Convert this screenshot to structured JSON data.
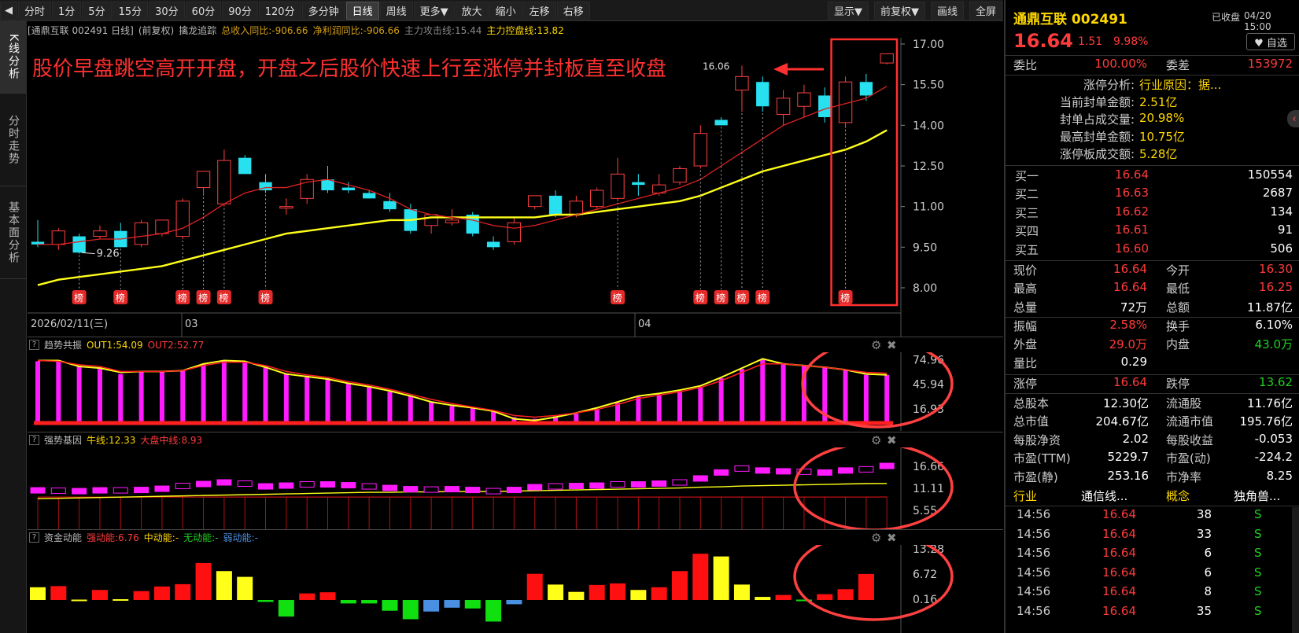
{
  "toolbar": {
    "left": [
      "分时",
      "1分",
      "5分",
      "15分",
      "30分",
      "60分",
      "90分",
      "120分",
      "多分钟",
      "日线",
      "周线",
      "更多▼",
      "放大",
      "缩小",
      "左移",
      "右移"
    ],
    "active": "日线",
    "right": [
      "显示▼",
      "前复权▼",
      "画线",
      "全屏"
    ]
  },
  "sidebar": {
    "tabs": [
      "K线分析",
      "分时走势",
      "基本面分析"
    ]
  },
  "kline": {
    "header": {
      "stock": "[通鼎互联 002491 日线]",
      "adj": "(前复权)",
      "indicator_name": "擒龙追踪",
      "revenue_label": "总收入同比:-906.66",
      "profit_label": "净利润同比:-906.66",
      "attack_label": "主力攻击线:15.44",
      "control_label": "主力控盘线:13.82"
    },
    "annotation": "股价早盘跳空高开开盘，开盘之后股价快速上行至涨停并封板直至收盘",
    "low_label": "9.26",
    "high_label": "16.06",
    "date_label": "2026/02/11(三)",
    "month_labels": [
      "03",
      "04"
    ],
    "y_ticks": [
      "17.00",
      "15.50",
      "14.00",
      "12.50",
      "11.00",
      "9.50",
      "8.00"
    ],
    "bang": "榜"
  },
  "panel1": {
    "name": "趋势共振",
    "out1": "OUT1:54.09",
    "out2": "OUT2:52.77",
    "y_ticks": [
      "74.96",
      "45.94",
      "16.93"
    ]
  },
  "panel2": {
    "name": "强势基因",
    "bull": "牛线:12.33",
    "market": "大盘中线:8.93",
    "y_ticks": [
      "16.66",
      "11.11",
      "5.55"
    ]
  },
  "panel3": {
    "name": "资金动能",
    "strong": "强动能:6.76",
    "mid": "中动能:-",
    "none": "无动能:-",
    "weak": "弱动能:-",
    "y_ticks": [
      "13.28",
      "6.72",
      "0.16"
    ]
  },
  "quote": {
    "title": "通鼎互联 002491",
    "status": "已收盘",
    "time": "04/20 15:00",
    "price": "16.64",
    "change": "1.51",
    "pct": "9.98%",
    "watch": "♥ 自选",
    "weibi_label": "委比",
    "weibi": "100.00%",
    "weicha_label": "委差",
    "weicha": "153972",
    "limit_rows": [
      {
        "k": "涨停分析:",
        "v": "行业原因：据..."
      },
      {
        "k": "当前封单金额:",
        "v": "2.51亿"
      },
      {
        "k": "封单占成交量:",
        "v": "20.98%"
      },
      {
        "k": "最高封单金额:",
        "v": "10.75亿"
      },
      {
        "k": "涨停板成交额:",
        "v": "5.28亿"
      }
    ],
    "bids": [
      {
        "k": "买一",
        "p": "16.64",
        "v": "150554"
      },
      {
        "k": "买二",
        "p": "16.63",
        "v": "2687"
      },
      {
        "k": "买三",
        "p": "16.62",
        "v": "134"
      },
      {
        "k": "买四",
        "p": "16.61",
        "v": "91"
      },
      {
        "k": "买五",
        "p": "16.60",
        "v": "506"
      }
    ],
    "stats": [
      {
        "k1": "现价",
        "v1": "16.64",
        "c1": "red",
        "k2": "今开",
        "v2": "16.30",
        "c2": "red"
      },
      {
        "k1": "最高",
        "v1": "16.64",
        "c1": "red",
        "k2": "最低",
        "v2": "16.25",
        "c2": "red"
      },
      {
        "k1": "总量",
        "v1": "72万",
        "c1": "white",
        "k2": "总额",
        "v2": "11.87亿",
        "c2": "white"
      }
    ],
    "stats2": [
      {
        "k1": "振幅",
        "v1": "2.58%",
        "c1": "red",
        "k2": "换手",
        "v2": "6.10%",
        "c2": "white"
      },
      {
        "k1": "外盘",
        "v1": "29.0万",
        "c1": "red",
        "k2": "内盘",
        "v2": "43.0万",
        "c2": "green"
      },
      {
        "k1": "量比",
        "v1": "0.29",
        "c1": "white",
        "k2": "",
        "v2": "",
        "c2": "white"
      }
    ],
    "stats3": [
      {
        "k1": "涨停",
        "v1": "16.64",
        "c1": "red",
        "k2": "跌停",
        "v2": "13.62",
        "c2": "green"
      }
    ],
    "fund": [
      {
        "k1": "总股本",
        "v1": "12.30亿",
        "k2": "流通股",
        "v2": "11.76亿"
      },
      {
        "k1": "总市值",
        "v1": "204.67亿",
        "k2": "流通市值",
        "v2": "195.76亿"
      },
      {
        "k1": "每股净资",
        "v1": "2.02",
        "k2": "每股收益",
        "v2": "-0.053"
      },
      {
        "k1": "市盈(TTM)",
        "v1": "5229.7",
        "k2": "市盈(动)",
        "v2": "-224.2"
      },
      {
        "k1": "市盈(静)",
        "v1": "253.16",
        "k2": "市净率",
        "v2": "8.25"
      }
    ],
    "industry_label": "行业",
    "industry": "通信线...",
    "concept_label": "概念",
    "concept": "独角兽...",
    "ticks": [
      {
        "t": "14:56",
        "p": "16.64",
        "v": "38",
        "s": "S"
      },
      {
        "t": "14:56",
        "p": "16.64",
        "v": "33",
        "s": "S"
      },
      {
        "t": "14:56",
        "p": "16.64",
        "v": "6",
        "s": "S"
      },
      {
        "t": "14:56",
        "p": "16.64",
        "v": "6",
        "s": "S"
      },
      {
        "t": "14:56",
        "p": "16.64",
        "v": "8",
        "s": "S"
      },
      {
        "t": "14:56",
        "p": "16.64",
        "v": "35",
        "s": "S"
      }
    ]
  },
  "chart_data": [
    {
      "type": "candlestick",
      "title": "通鼎互联 002491 日线",
      "ylim": [
        8.0,
        17.0
      ],
      "y_ticks": [
        8.0,
        9.5,
        11.0,
        12.5,
        14.0,
        15.5,
        17.0
      ],
      "candles": [
        {
          "o": 9.7,
          "h": 10.5,
          "l": 9.5,
          "c": 9.6
        },
        {
          "o": 9.6,
          "h": 10.2,
          "l": 9.4,
          "c": 10.1
        },
        {
          "o": 9.9,
          "h": 10.0,
          "l": 9.26,
          "c": 9.3
        },
        {
          "o": 9.9,
          "h": 10.3,
          "l": 9.8,
          "c": 10.1
        },
        {
          "o": 10.1,
          "h": 10.4,
          "l": 9.5,
          "c": 9.5
        },
        {
          "o": 9.6,
          "h": 10.5,
          "l": 9.5,
          "c": 10.4
        },
        {
          "o": 10.0,
          "h": 10.5,
          "l": 9.9,
          "c": 10.5
        },
        {
          "o": 9.9,
          "h": 11.3,
          "l": 9.8,
          "c": 11.2
        },
        {
          "o": 11.7,
          "h": 12.3,
          "l": 11.4,
          "c": 12.3
        },
        {
          "o": 11.1,
          "h": 13.1,
          "l": 11.0,
          "c": 12.7
        },
        {
          "o": 12.8,
          "h": 12.9,
          "l": 12.3,
          "c": 12.2
        },
        {
          "o": 11.9,
          "h": 12.2,
          "l": 11.5,
          "c": 11.6
        },
        {
          "o": 11.0,
          "h": 11.3,
          "l": 10.7,
          "c": 11.0
        },
        {
          "o": 11.3,
          "h": 12.2,
          "l": 11.1,
          "c": 12.0
        },
        {
          "o": 12.0,
          "h": 12.5,
          "l": 11.5,
          "c": 11.6
        },
        {
          "o": 11.7,
          "h": 11.9,
          "l": 11.5,
          "c": 11.6
        },
        {
          "o": 11.5,
          "h": 11.6,
          "l": 11.3,
          "c": 11.3
        },
        {
          "o": 11.2,
          "h": 11.5,
          "l": 10.8,
          "c": 10.9
        },
        {
          "o": 10.9,
          "h": 11.1,
          "l": 10.0,
          "c": 10.1
        },
        {
          "o": 10.3,
          "h": 10.7,
          "l": 10.0,
          "c": 10.7
        },
        {
          "o": 10.4,
          "h": 10.9,
          "l": 10.3,
          "c": 10.5
        },
        {
          "o": 10.7,
          "h": 10.8,
          "l": 9.9,
          "c": 10.0
        },
        {
          "o": 9.7,
          "h": 9.9,
          "l": 9.4,
          "c": 9.5
        },
        {
          "o": 9.7,
          "h": 10.6,
          "l": 9.6,
          "c": 10.4
        },
        {
          "o": 11.0,
          "h": 11.4,
          "l": 10.9,
          "c": 11.4
        },
        {
          "o": 11.4,
          "h": 11.6,
          "l": 10.6,
          "c": 10.7
        },
        {
          "o": 10.7,
          "h": 11.4,
          "l": 10.6,
          "c": 11.2
        },
        {
          "o": 11.0,
          "h": 11.7,
          "l": 10.9,
          "c": 11.6
        },
        {
          "o": 11.3,
          "h": 12.8,
          "l": 11.2,
          "c": 12.2
        },
        {
          "o": 11.9,
          "h": 12.2,
          "l": 11.4,
          "c": 11.8
        },
        {
          "o": 11.5,
          "h": 12.2,
          "l": 11.4,
          "c": 11.8
        },
        {
          "o": 11.9,
          "h": 12.5,
          "l": 11.8,
          "c": 12.4
        },
        {
          "o": 12.5,
          "h": 14.0,
          "l": 12.4,
          "c": 13.7
        },
        {
          "o": 14.2,
          "h": 14.3,
          "l": 14.0,
          "c": 14.0
        },
        {
          "o": 15.3,
          "h": 16.2,
          "l": 14.5,
          "c": 15.8
        },
        {
          "o": 15.6,
          "h": 15.8,
          "l": 14.5,
          "c": 14.7
        },
        {
          "o": 14.4,
          "h": 15.3,
          "l": 14.0,
          "c": 15.0
        },
        {
          "o": 14.7,
          "h": 15.5,
          "l": 14.3,
          "c": 15.2
        },
        {
          "o": 15.1,
          "h": 15.4,
          "l": 14.1,
          "c": 14.3
        },
        {
          "o": 14.1,
          "h": 15.8,
          "l": 13.9,
          "c": 15.6
        },
        {
          "o": 15.6,
          "h": 15.9,
          "l": 14.9,
          "c": 15.1
        },
        {
          "o": 16.3,
          "h": 16.64,
          "l": 16.25,
          "c": 16.64
        }
      ],
      "ma_attack": [
        9.6,
        9.6,
        9.7,
        9.8,
        9.8,
        9.9,
        10.0,
        10.2,
        10.6,
        11.1,
        11.5,
        11.7,
        11.7,
        11.9,
        12.0,
        11.8,
        11.6,
        11.3,
        10.9,
        10.7,
        10.6,
        10.5,
        10.3,
        10.2,
        10.3,
        10.5,
        10.7,
        10.9,
        11.1,
        11.3,
        11.5,
        11.7,
        12.0,
        12.5,
        13.0,
        13.5,
        14.0,
        14.3,
        14.6,
        14.8,
        15.0,
        15.44
      ],
      "ma_control": [
        8.1,
        8.3,
        8.4,
        8.5,
        8.6,
        8.7,
        8.8,
        9.0,
        9.2,
        9.4,
        9.6,
        9.8,
        10.0,
        10.1,
        10.2,
        10.3,
        10.4,
        10.5,
        10.5,
        10.6,
        10.6,
        10.6,
        10.6,
        10.6,
        10.6,
        10.7,
        10.7,
        10.8,
        10.9,
        11.0,
        11.1,
        11.2,
        11.4,
        11.7,
        12.0,
        12.3,
        12.5,
        12.7,
        12.9,
        13.1,
        13.4,
        13.82
      ],
      "bang_days": [
        2,
        4,
        7,
        8,
        9,
        11,
        28,
        32,
        33,
        34,
        35,
        39
      ]
    },
    {
      "type": "bar",
      "title": "趋势共振",
      "ylim": [
        0,
        80
      ],
      "y_ticks": [
        16.93,
        45.94,
        74.96
      ],
      "values": [
        73,
        73,
        68,
        66,
        58,
        61,
        61,
        63,
        70,
        73,
        72,
        67,
        58,
        56,
        53,
        47,
        43,
        37,
        32,
        25,
        20,
        18,
        14,
        7,
        5,
        8,
        11,
        17,
        24,
        31,
        34,
        38,
        43,
        53,
        64,
        75,
        71,
        68,
        67,
        63,
        57,
        57,
        55,
        54.09
      ],
      "out1": [
        74,
        74,
        67,
        65,
        60,
        61,
        61,
        62,
        70,
        74,
        73,
        66,
        58,
        55,
        52,
        47,
        43,
        38,
        32,
        25,
        21,
        18,
        14,
        5,
        3,
        7,
        12,
        18,
        25,
        32,
        35,
        39,
        44,
        54,
        65,
        76,
        70,
        68,
        66,
        63,
        58,
        57,
        56,
        54.09
      ],
      "out2": [
        74,
        73,
        69,
        67,
        61,
        61,
        61,
        62,
        68,
        72,
        72,
        68,
        61,
        57,
        54,
        49,
        45,
        40,
        34,
        28,
        23,
        19,
        15,
        9,
        7,
        9,
        12,
        16,
        22,
        29,
        33,
        37,
        42,
        50,
        60,
        70,
        70,
        68,
        66,
        63,
        60,
        59,
        57,
        52.77
      ]
    },
    {
      "type": "bar",
      "title": "强势基因",
      "ylim": [
        0,
        20
      ],
      "y_ticks": [
        5.55,
        11.11,
        16.66
      ],
      "values": [
        10.5,
        10.4,
        10.3,
        10.5,
        10.5,
        10.6,
        10.9,
        11.6,
        12.1,
        12.5,
        12.2,
        11.5,
        11.7,
        12.0,
        12.0,
        11.8,
        11.5,
        11.1,
        10.8,
        10.7,
        10.8,
        10.6,
        10.3,
        10.6,
        11.3,
        11.5,
        11.6,
        11.7,
        12.0,
        12.0,
        12.2,
        12.5,
        13.5,
        15.0,
        16.0,
        15.5,
        15.3,
        15.2,
        15.0,
        15.5,
        15.8,
        16.66
      ],
      "bull": [
        8.5,
        8.6,
        8.7,
        8.8,
        8.9,
        9.0,
        9.1,
        9.2,
        9.3,
        9.4,
        9.5,
        9.6,
        9.7,
        9.8,
        9.9,
        10.0,
        10.1,
        10.1,
        10.2,
        10.2,
        10.3,
        10.3,
        10.3,
        10.4,
        10.5,
        10.6,
        10.7,
        10.8,
        10.9,
        11.0,
        11.1,
        11.2,
        11.4,
        11.5,
        11.7,
        11.8,
        11.9,
        12.0,
        12.1,
        12.2,
        12.3,
        12.33
      ],
      "market": [
        8.9,
        8.9,
        8.9,
        8.9,
        8.9,
        8.9,
        8.9,
        8.9,
        8.9,
        8.9,
        8.9,
        8.9,
        8.9,
        8.9,
        8.9,
        8.9,
        8.9,
        8.9,
        8.9,
        8.9,
        8.9,
        8.9,
        8.9,
        8.9,
        8.9,
        8.9,
        8.9,
        8.9,
        8.9,
        8.9,
        8.9,
        8.9,
        8.9,
        8.9,
        8.9,
        8.9,
        8.9,
        8.9,
        8.9,
        8.9,
        8.9,
        8.93
      ]
    },
    {
      "type": "bar",
      "title": "资金动能",
      "ylim": [
        -4,
        14
      ],
      "y_ticks": [
        0.16,
        6.72,
        13.28
      ],
      "values": [
        3.3,
        3.6,
        0.1,
        2.6,
        0.2,
        2.3,
        3.5,
        4.1,
        9.6,
        7.5,
        6.0,
        -0.5,
        -4.3,
        1.7,
        2.0,
        -0.9,
        -0.9,
        -2.8,
        -5.0,
        -3.0,
        -2.0,
        -2.2,
        -5.6,
        -1.1,
        6.8,
        4.0,
        2.1,
        3.9,
        4.3,
        2.6,
        3.3,
        7.5,
        12.0,
        11.3,
        4.0,
        0.8,
        1.3,
        0.1,
        1.5,
        2.8,
        6.76
      ],
      "colors": [
        "y",
        "r",
        "y",
        "r",
        "y",
        "r",
        "r",
        "r",
        "r",
        "y",
        "y",
        "g",
        "g",
        "r",
        "r",
        "g",
        "g",
        "g",
        "g",
        "b",
        "b",
        "g",
        "g",
        "b",
        "r",
        "y",
        "y",
        "r",
        "r",
        "y",
        "r",
        "r",
        "r",
        "y",
        "y",
        "y",
        "r",
        "g",
        "r",
        "r",
        "r"
      ]
    }
  ]
}
